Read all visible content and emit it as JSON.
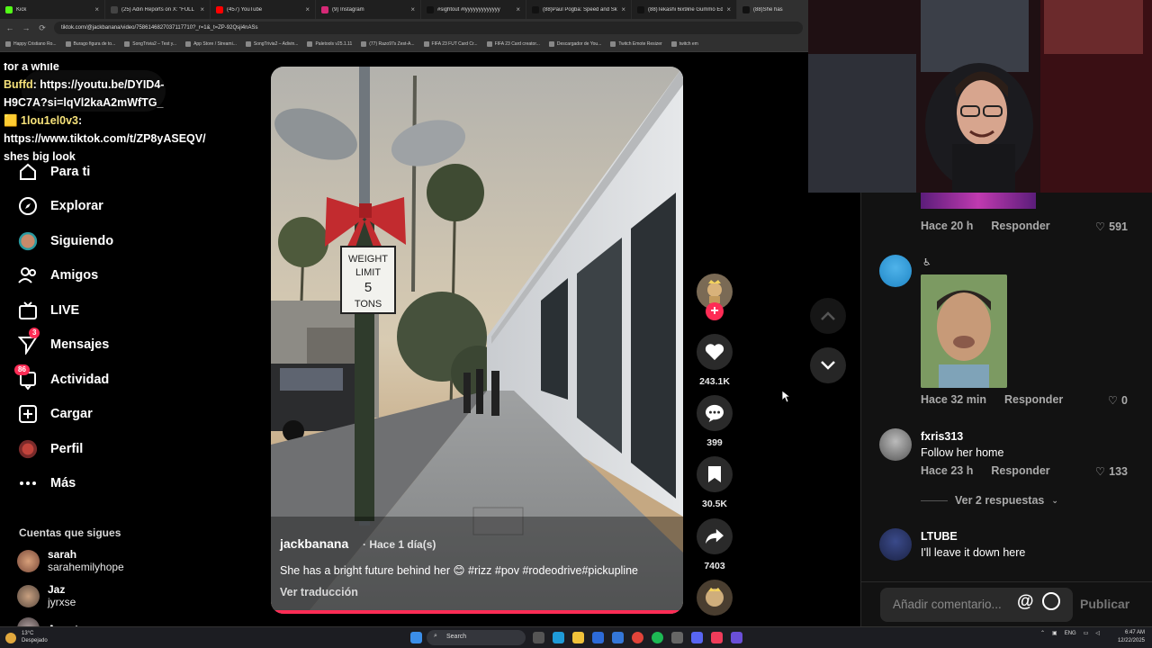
{
  "browser": {
    "tabs": [
      {
        "title": "Kick",
        "color": "#53fc18"
      },
      {
        "title": "(25) Adin Reports on X: \"FULL",
        "color": "#444444"
      },
      {
        "title": "(457) YouTube",
        "color": "#ff0000"
      },
      {
        "title": "(9) Instagram",
        "color": "#d62976"
      },
      {
        "title": "#sightout #lyyyyyyyyyyyyy",
        "color": "#111111"
      },
      {
        "title": "(88)Paul Pogba: Speed and Ski",
        "color": "#111111"
      },
      {
        "title": "(88)Tekashi 6ix9ine Gummo Ed",
        "color": "#111111"
      },
      {
        "title": "(88)She has",
        "color": "#111111"
      }
    ],
    "url": "tiktok.com/@jackbanana/video/7586146827037117710?_r=1&_t=ZP-92Qsji4nASs",
    "bookmarks": [
      "Happy Cristiano Ro...",
      "Burago figura de to...",
      "SongTrivia2 – Test y...",
      "App Store / Streami...",
      "SongTrivia2 – Adivin...",
      "Paletools v25.1.11",
      "(77) Razo97s Zest-A...",
      "FIFA 23 FUT Card Cr...",
      "FIFA 23 Card creator...",
      "Descargador de You...",
      "Twitch Emote Resizer",
      "twitch em"
    ]
  },
  "chat": [
    {
      "name": "for a while",
      "text": ""
    },
    {
      "name": "Buffd",
      "text": ": https://youtu.be/DYID4-H9C7A?si=lqVl2kaA2mWfTG_"
    },
    {
      "name": "1lou1el0v3",
      "text": ": https://www.tiktok.com/t/ZP8yASEQV/ shes big look"
    }
  ],
  "nav": {
    "items": [
      {
        "label": "Para ti"
      },
      {
        "label": "Explorar"
      },
      {
        "label": "Siguiendo"
      },
      {
        "label": "Amigos"
      },
      {
        "label": "LIVE"
      },
      {
        "label": "Mensajes",
        "badge": "3"
      },
      {
        "label": "Actividad",
        "badge": "86"
      },
      {
        "label": "Cargar"
      },
      {
        "label": "Perfil"
      },
      {
        "label": "Más"
      }
    ],
    "following_title": "Cuentas que sigues",
    "following": [
      {
        "name": "sarah",
        "handle": "sarahemilyhope"
      },
      {
        "name": "Jaz",
        "handle": "jyrxse"
      },
      {
        "name": "Annet",
        "handle": ""
      }
    ]
  },
  "video": {
    "author": "jackbanana",
    "time": "· Hace 1 día(s)",
    "caption": "She has a bright future behind her 😊 #rizz #pov #rodeodrive#pickupline",
    "translate": "Ver traducción",
    "sign_lines": [
      "WEIGHT",
      "LIMIT",
      "5",
      "TONS"
    ],
    "progress": 1.0
  },
  "actions": {
    "likes": "243.1K",
    "comments": "399",
    "saves": "30.5K",
    "shares": "7403"
  },
  "comments": [
    {
      "name": "",
      "text": "",
      "time": "Hace 20 h",
      "reply": "Responder",
      "likes": "591"
    },
    {
      "name": "",
      "text": "",
      "time": "Hace 32 min",
      "reply": "Responder",
      "likes": "0"
    },
    {
      "name": "fxris313",
      "text": "Follow her home",
      "time": "Hace 23 h",
      "reply": "Responder",
      "likes": "133"
    },
    {
      "name": "LTUBE",
      "text": "I'll leave it down here",
      "time": "",
      "reply": "",
      "likes": ""
    }
  ],
  "replies_label": "Ver 2 respuestas",
  "comment_input": {
    "placeholder": "Añadir comentario...",
    "post": "Publicar"
  },
  "taskbar": {
    "weather_temp": "13°C",
    "weather_desc": "Despejado",
    "search": "Search",
    "lang": "ENG",
    "time": "6:47 AM",
    "date": "12/22/2025"
  }
}
